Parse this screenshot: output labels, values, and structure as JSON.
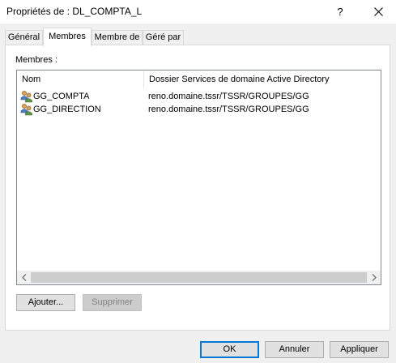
{
  "window": {
    "title": "Propriétés de : DL_COMPTA_L",
    "help_label": "?",
    "close_label": "✕"
  },
  "tabs": [
    {
      "label": "Général"
    },
    {
      "label": "Membres"
    },
    {
      "label": "Membre de"
    },
    {
      "label": "Géré par"
    }
  ],
  "members": {
    "group_label": "Membres :",
    "columns": {
      "name": "Nom",
      "folder": "Dossier Services de domaine Active Directory"
    },
    "rows": [
      {
        "name": "GG_COMPTA",
        "folder": "reno.domaine.tssr/TSSR/GROUPES/GG",
        "icon": "group-icon"
      },
      {
        "name": "GG_DIRECTION",
        "folder": "reno.domaine.tssr/TSSR/GROUPES/GG",
        "icon": "group-icon"
      }
    ],
    "scroll": {
      "left": "<",
      "right": ">"
    }
  },
  "actions": {
    "add_label": "Ajouter...",
    "remove_label": "Supprimer"
  },
  "footer": {
    "ok_label": "OK",
    "cancel_label": "Annuler",
    "apply_label": "Appliquer"
  },
  "colors": {
    "accent": "#0078d7",
    "panel_background": "#ffffff",
    "window_background": "#f0f0f0"
  }
}
